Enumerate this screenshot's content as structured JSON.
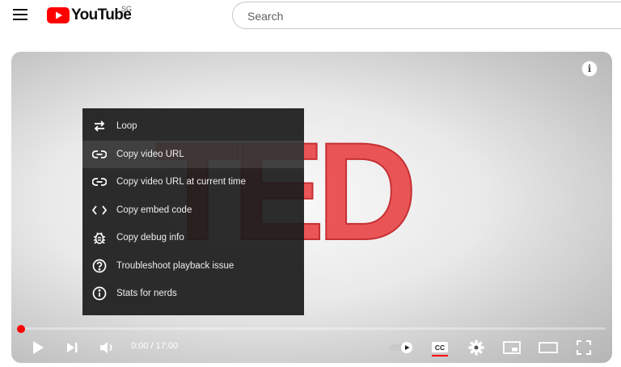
{
  "header": {
    "logo_text": "YouTube",
    "region_code": "SG",
    "search_placeholder": "Search"
  },
  "player": {
    "logo_letters": "TED",
    "info_icon": "i",
    "context_menu": [
      {
        "label": "Loop",
        "icon": "loop-icon"
      },
      {
        "label": "Copy video URL",
        "icon": "link-icon"
      },
      {
        "label": "Copy video URL at current time",
        "icon": "link-icon"
      },
      {
        "label": "Copy embed code",
        "icon": "code-icon"
      },
      {
        "label": "Copy debug info",
        "icon": "bug-icon"
      },
      {
        "label": "Troubleshoot playback issue",
        "icon": "question-icon"
      },
      {
        "label": "Stats for nerds",
        "icon": "info-icon"
      }
    ],
    "time_display": "0:00 / 17:00",
    "progress_fraction": 0.0,
    "cc_label": "CC",
    "autoplay_on": true,
    "colors": {
      "progress": "#ff0000",
      "ted_red": "#e62b1e",
      "menu_bg": "#1c1c1c"
    }
  }
}
